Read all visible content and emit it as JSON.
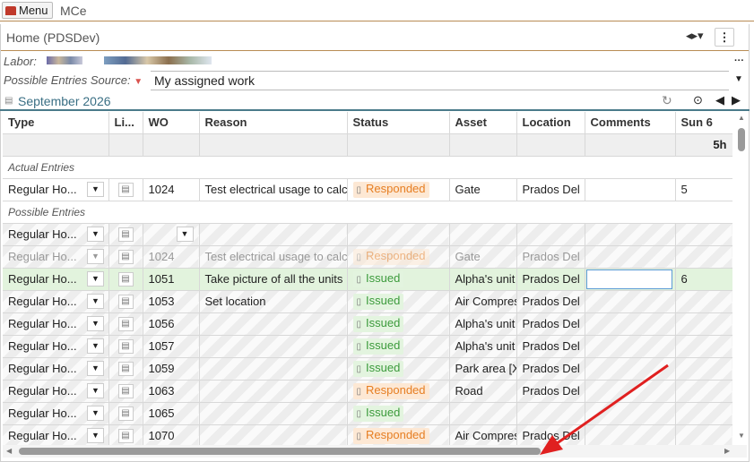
{
  "topbar": {
    "menu_label": "Menu",
    "app_name": "MCe"
  },
  "panel": {
    "title": "Home (PDSDev)"
  },
  "labor": {
    "label": "Labor:"
  },
  "source": {
    "label": "Possible Entries Source:",
    "value": "My assigned work"
  },
  "month": {
    "label": "September 2026"
  },
  "columns": [
    "Type",
    "Li...",
    "WO",
    "Reason",
    "Status",
    "Asset",
    "Location",
    "Comments",
    "Sun 6"
  ],
  "day_total": "5h",
  "sections": {
    "actual": "Actual Entries",
    "possible": "Possible Entries"
  },
  "actual_rows": [
    {
      "type": "Regular Ho...",
      "wo": "1024",
      "reason": "Test electrical usage to calc",
      "status": "Responded",
      "asset": "Gate",
      "location": "Prados Del",
      "comments": "",
      "hours": "5"
    }
  ],
  "possible_rows": [
    {
      "type": "Regular Ho...",
      "wo": "",
      "reason": "",
      "status": "",
      "asset": "",
      "location": "",
      "hours": ""
    },
    {
      "type": "Regular Ho...",
      "wo": "1024",
      "reason": "Test electrical usage to calc",
      "status": "Responded",
      "asset": "Gate",
      "location": "Prados Del",
      "hours": ""
    },
    {
      "type": "Regular Ho...",
      "wo": "1051",
      "reason": "Take picture of all the units",
      "status": "Issued",
      "asset": "Alpha's unit",
      "location": "Prados Del",
      "hours": "6"
    },
    {
      "type": "Regular Ho...",
      "wo": "1053",
      "reason": "Set location",
      "status": "Issued",
      "asset": "Air Compres",
      "location": "Prados Del",
      "hours": ""
    },
    {
      "type": "Regular Ho...",
      "wo": "1056",
      "reason": "",
      "status": "Issued",
      "asset": "Alpha's unit",
      "location": "Prados Del",
      "hours": ""
    },
    {
      "type": "Regular Ho...",
      "wo": "1057",
      "reason": "",
      "status": "Issued",
      "asset": "Alpha's unit",
      "location": "Prados Del",
      "hours": ""
    },
    {
      "type": "Regular Ho...",
      "wo": "1059",
      "reason": "",
      "status": "Issued",
      "asset": "Park area [X",
      "location": "Prados Del",
      "hours": ""
    },
    {
      "type": "Regular Ho...",
      "wo": "1063",
      "reason": "",
      "status": "Responded",
      "asset": "Road",
      "location": "Prados Del",
      "hours": ""
    },
    {
      "type": "Regular Ho...",
      "wo": "1065",
      "reason": "",
      "status": "Issued",
      "asset": "",
      "location": "",
      "hours": ""
    },
    {
      "type": "Regular Ho...",
      "wo": "1070",
      "reason": "",
      "status": "Responded",
      "asset": "Air Compres",
      "location": "Prados Del",
      "hours": ""
    }
  ],
  "icons": [
    "menu-home-icon",
    "split-view-icon",
    "kebab-icon",
    "pin-icon",
    "calendar-icon",
    "refresh-icon",
    "location-icon",
    "prev-arrow-icon",
    "next-arrow-icon",
    "dropdown-icon",
    "note-icon"
  ],
  "colors": {
    "issued": "#3c9b3c",
    "responded": "#e67e22",
    "accent_line": "#b98c54",
    "edit_border": "#5b9bd5"
  }
}
